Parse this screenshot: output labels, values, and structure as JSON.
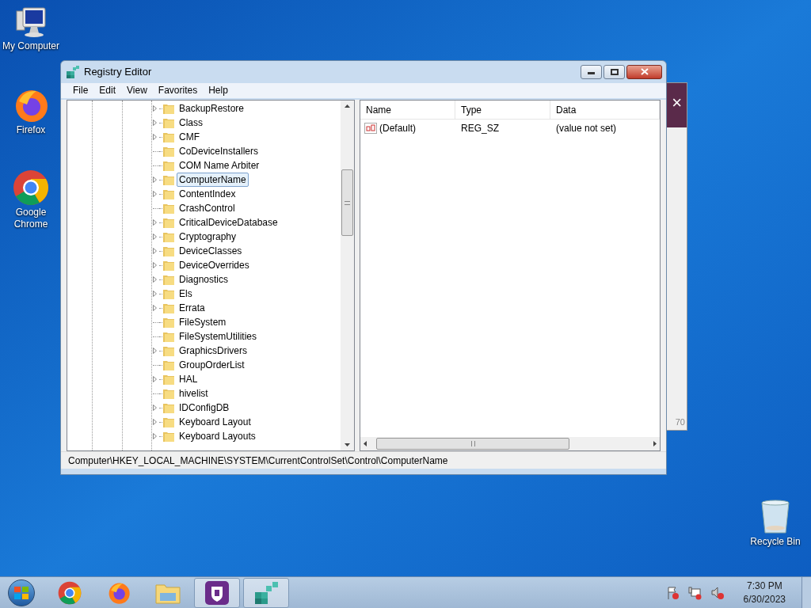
{
  "desktop_icons": [
    {
      "kind": "computer",
      "label": "My Computer"
    },
    {
      "kind": "firefox",
      "label": "Firefox"
    },
    {
      "kind": "chrome",
      "label": "Google Chrome"
    },
    {
      "kind": "recycle",
      "label": "Recycle Bin"
    }
  ],
  "background_window": {
    "close": "×",
    "text": "70"
  },
  "window": {
    "title": "Registry Editor",
    "menu": [
      "File",
      "Edit",
      "View",
      "Favorites",
      "Help"
    ],
    "tree": [
      {
        "label": "BackupRestore",
        "expandable": true,
        "selected": false
      },
      {
        "label": "Class",
        "expandable": true,
        "selected": false
      },
      {
        "label": "CMF",
        "expandable": true,
        "selected": false
      },
      {
        "label": "CoDeviceInstallers",
        "expandable": false,
        "selected": false
      },
      {
        "label": "COM Name Arbiter",
        "expandable": false,
        "selected": false
      },
      {
        "label": "ComputerName",
        "expandable": true,
        "selected": true
      },
      {
        "label": "ContentIndex",
        "expandable": true,
        "selected": false
      },
      {
        "label": "CrashControl",
        "expandable": false,
        "selected": false
      },
      {
        "label": "CriticalDeviceDatabase",
        "expandable": true,
        "selected": false
      },
      {
        "label": "Cryptography",
        "expandable": true,
        "selected": false
      },
      {
        "label": "DeviceClasses",
        "expandable": true,
        "selected": false
      },
      {
        "label": "DeviceOverrides",
        "expandable": true,
        "selected": false
      },
      {
        "label": "Diagnostics",
        "expandable": true,
        "selected": false
      },
      {
        "label": "Els",
        "expandable": true,
        "selected": false
      },
      {
        "label": "Errata",
        "expandable": true,
        "selected": false
      },
      {
        "label": "FileSystem",
        "expandable": false,
        "selected": false
      },
      {
        "label": "FileSystemUtilities",
        "expandable": false,
        "selected": false
      },
      {
        "label": "GraphicsDrivers",
        "expandable": true,
        "selected": false
      },
      {
        "label": "GroupOrderList",
        "expandable": false,
        "selected": false
      },
      {
        "label": "HAL",
        "expandable": true,
        "selected": false
      },
      {
        "label": "hivelist",
        "expandable": false,
        "selected": false
      },
      {
        "label": "IDConfigDB",
        "expandable": true,
        "selected": false
      },
      {
        "label": "Keyboard Layout",
        "expandable": true,
        "selected": false
      },
      {
        "label": "Keyboard Layouts",
        "expandable": true,
        "selected": false
      }
    ],
    "values": {
      "columns": [
        "Name",
        "Type",
        "Data"
      ],
      "rows": [
        {
          "name": "(Default)",
          "type": "REG_SZ",
          "data": "(value not set)"
        }
      ]
    },
    "status_bar": "Computer\\HKEY_LOCAL_MACHINE\\SYSTEM\\CurrentControlSet\\Control\\ComputerName"
  },
  "taskbar": {
    "items": [
      {
        "kind": "chrome",
        "selected": false
      },
      {
        "kind": "firefox",
        "selected": false
      },
      {
        "kind": "explorer",
        "selected": false
      },
      {
        "kind": "shield",
        "selected": true
      },
      {
        "kind": "regedit",
        "selected": true
      }
    ],
    "time": "7:30 PM",
    "date": "6/30/2023"
  }
}
